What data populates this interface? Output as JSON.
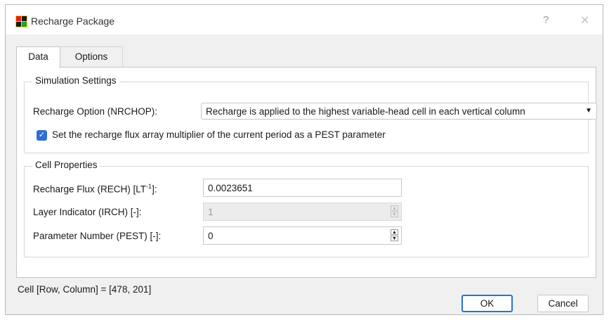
{
  "window": {
    "title": "Recharge Package",
    "help_label": "?",
    "close_label": "✕"
  },
  "tabs": [
    {
      "label": "Data",
      "active": true
    },
    {
      "label": "Options",
      "active": false
    }
  ],
  "simulation_settings": {
    "title": "Simulation Settings",
    "recharge_option_label": "Recharge Option (NRCHOP):",
    "recharge_option_value": "Recharge is applied to the highest variable-head cell in each vertical column",
    "pest_checkbox_label": "Set the recharge flux array multiplier of the current period as a PEST parameter",
    "pest_checkbox_checked": true
  },
  "cell_properties": {
    "title": "Cell Properties",
    "recharge_flux_label_main": "Recharge Flux (RECH) [LT",
    "recharge_flux_label_sup": "-1",
    "recharge_flux_label_end": "]:",
    "recharge_flux_value": "0.0023651",
    "layer_indicator_label": "Layer Indicator (IRCH) [-]:",
    "layer_indicator_value": "1",
    "parameter_number_label": "Parameter Number (PEST) [-]:",
    "parameter_number_value": "0"
  },
  "status": {
    "cell_text": "Cell [Row, Column] = [478, 201]"
  },
  "buttons": {
    "ok": "OK",
    "cancel": "Cancel"
  },
  "colors": {
    "accent": "#2f6fd1"
  }
}
